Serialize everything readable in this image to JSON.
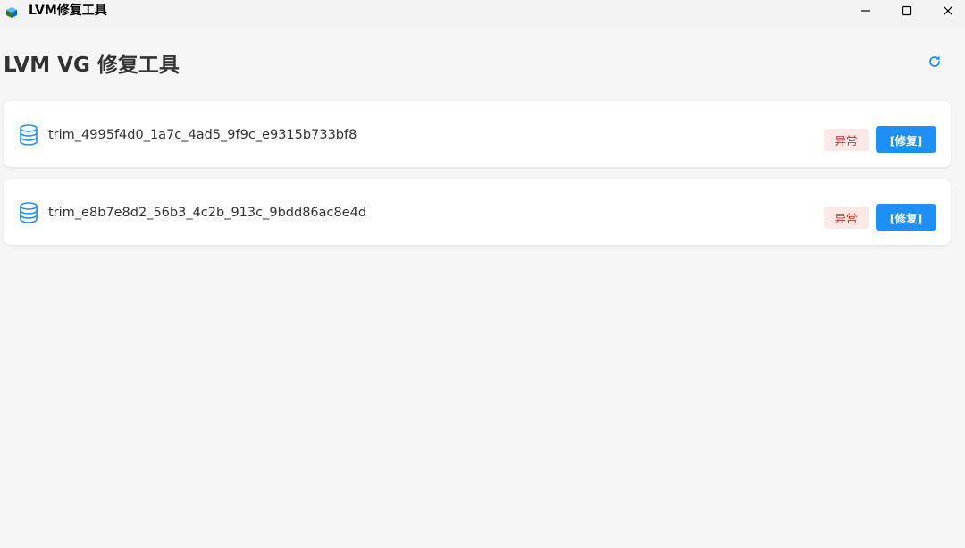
{
  "window": {
    "title": "LVM修复工具"
  },
  "header": {
    "title": "LVM VG 修复工具"
  },
  "volume_groups": [
    {
      "name": "trim_4995f4d0_1a7c_4ad5_9f9c_e9315b733bf8",
      "status": "异常",
      "action_label": "[修复]"
    },
    {
      "name": "trim_e8b7e8d2_56b3_4c2b_913c_9bdd86ac8e4d",
      "status": "异常",
      "action_label": "[修复]"
    }
  ],
  "icons": {
    "app": "app-cube-icon",
    "refresh": "refresh-icon",
    "volume": "database-icon",
    "minimize": "minimize-icon",
    "maximize": "maximize-icon",
    "close": "close-icon"
  },
  "colors": {
    "accent": "#1e90f5",
    "status_error_bg": "#fde8e8",
    "status_error_text": "#c0392b",
    "background": "#f5f5f5",
    "card": "#ffffff"
  }
}
